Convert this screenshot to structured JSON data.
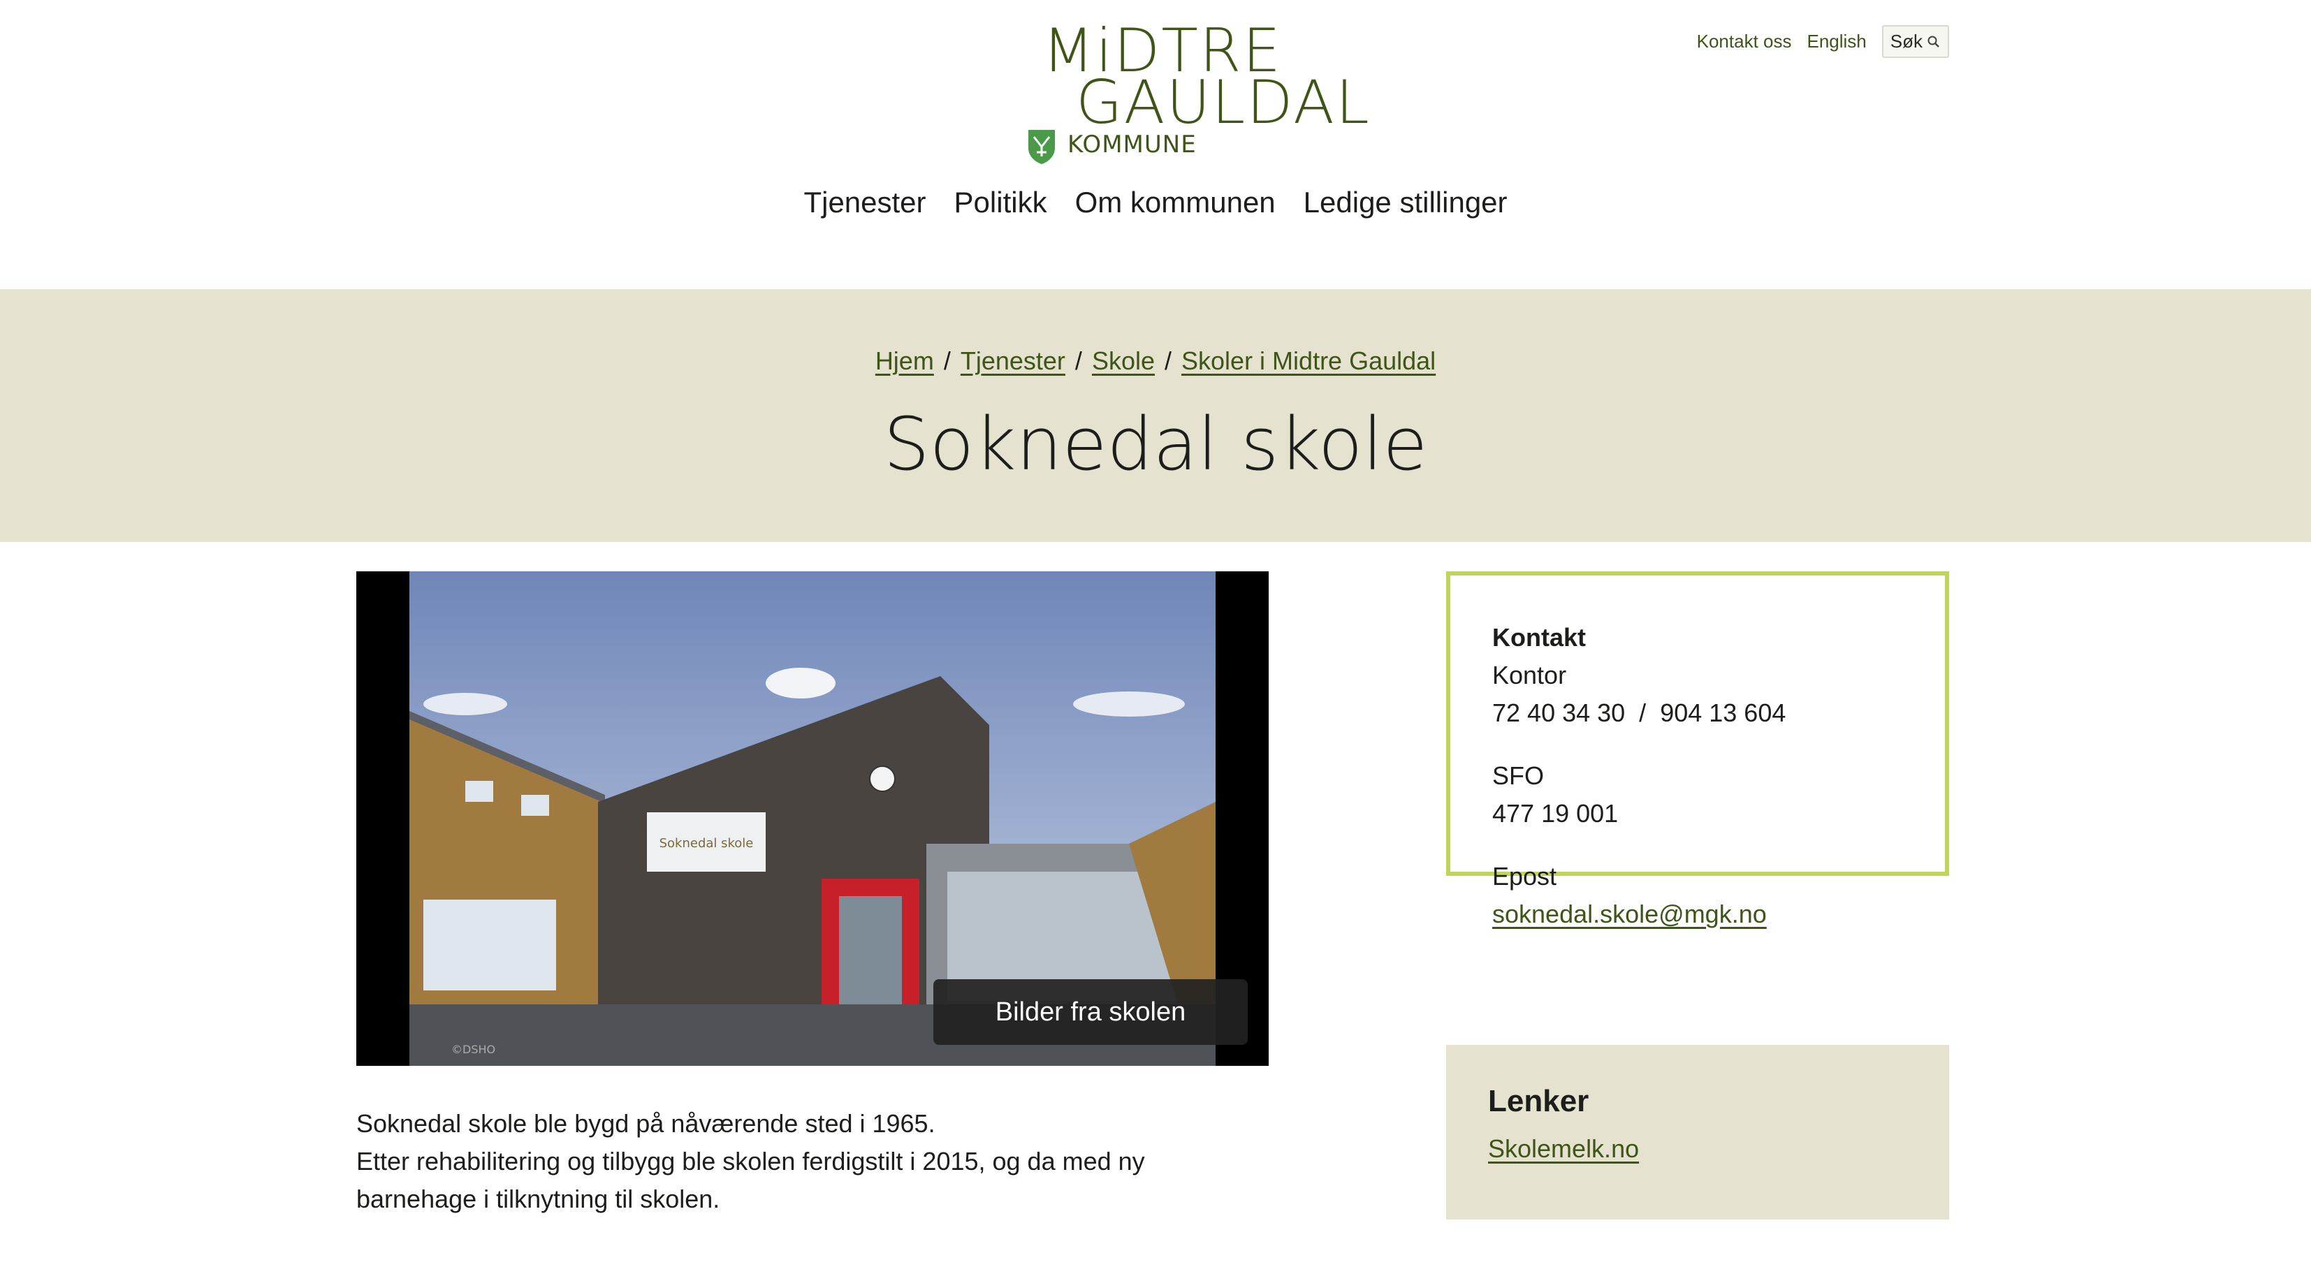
{
  "logo": {
    "line1": "MiDTRE",
    "line2": "GAULDAL",
    "line3": "KOMMUNE"
  },
  "utility": {
    "contact": "Kontakt oss",
    "english": "English",
    "search": "Søk"
  },
  "nav": [
    "Tjenester",
    "Politikk",
    "Om kommunen",
    "Ledige stillinger"
  ],
  "breadcrumb": [
    "Hjem",
    "Tjenester",
    "Skole",
    "Skoler i Midtre Gauldal"
  ],
  "page_title": "Soknedal skole",
  "hero": {
    "gallery_button": "Bilder fra skolen",
    "sign_text": "Soknedal skole",
    "watermark": "©DSHO"
  },
  "intro": {
    "line1": "Soknedal skole ble bygd på nåværende sted i 1965.",
    "line2": "Etter rehabilitering og tilbygg ble skolen ferdigstilt i 2015, og da med ny barnehage i tilknytning til skolen."
  },
  "contact": {
    "heading": "Kontakt",
    "office_label": "Kontor",
    "office_phone": "72 40 34 30  /  904 13 604",
    "sfo_label": "SFO",
    "sfo_phone": "477 19 001",
    "email_label": "Epost",
    "email": "soknedal.skole@mgk.no"
  },
  "links": {
    "heading": "Lenker",
    "items": [
      "Skolemelk.no"
    ]
  },
  "colors": {
    "accent": "#3f5417",
    "banner": "#e5e3d0",
    "border": "#c1d35a"
  }
}
